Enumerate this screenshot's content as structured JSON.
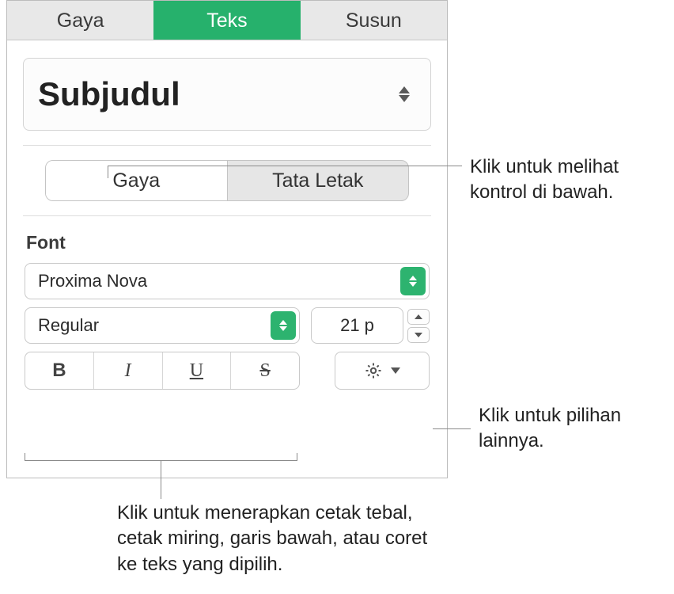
{
  "tabs": {
    "style": "Gaya",
    "text": "Teks",
    "arrange": "Susun"
  },
  "paragraph_style": {
    "value": "Subjudul"
  },
  "inner_tabs": {
    "style": "Gaya",
    "layout": "Tata Letak"
  },
  "font": {
    "label": "Font",
    "family": "Proxima Nova",
    "weight": "Regular",
    "size": "21 p",
    "bold": "B",
    "italic": "I",
    "underline": "U",
    "strike": "S"
  },
  "callouts": {
    "inner_tabs": "Klik untuk melihat kontrol di bawah.",
    "gear": "Klik untuk pilihan lainnya.",
    "bius": "Klik untuk menerapkan cetak tebal, cetak miring, garis bawah, atau coret ke teks yang dipilih."
  }
}
